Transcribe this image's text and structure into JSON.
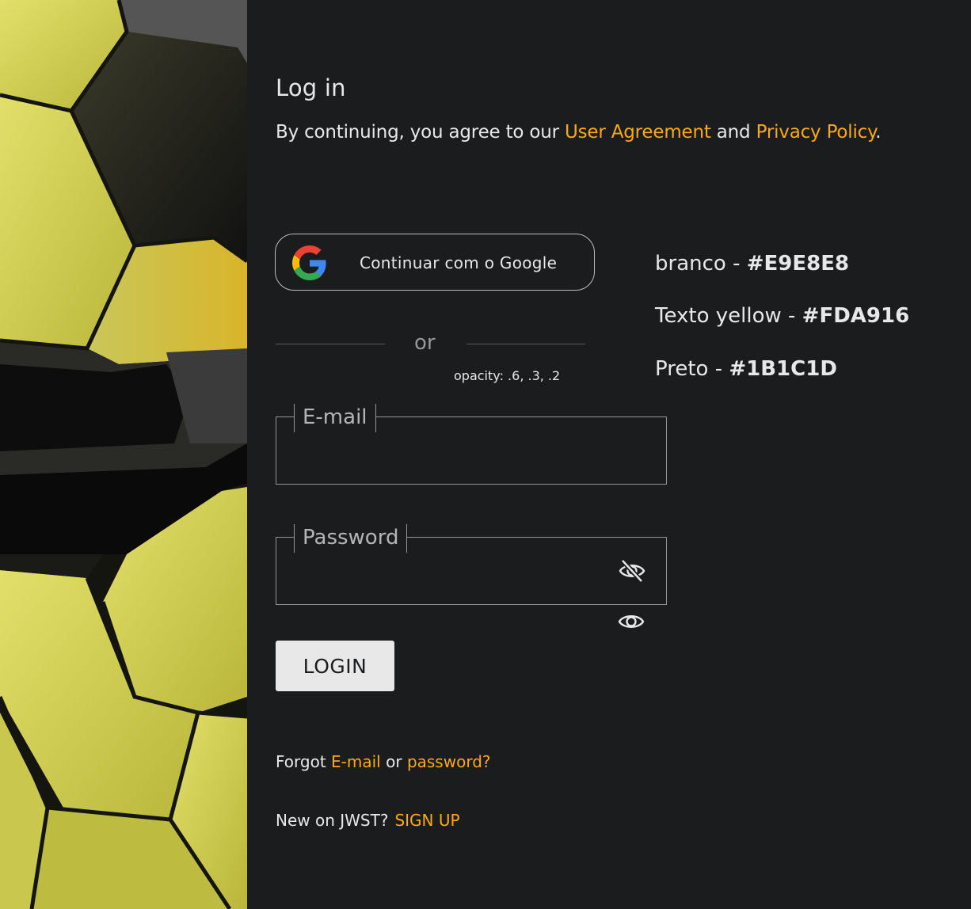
{
  "colors": {
    "white": "#E9E8E8",
    "yellow_text": "#FDA916",
    "black": "#1B1C1D",
    "hex_yellow": "#D3D34E"
  },
  "hero": {
    "image": "yellow-hexagon-tiles"
  },
  "login": {
    "title": "Log in",
    "agreement_prefix": "By continuing, you agree to our ",
    "user_agreement_link": "User Agreement",
    "agreement_and": " and ",
    "privacy_policy_link": "Privacy Policy",
    "agreement_suffix": ".",
    "google_button_label": "Continuar com o Google",
    "google_icon": "google-g-icon",
    "or_label": "or",
    "opacity_note": "opacity: .6, .3, .2",
    "email_label": "E-mail",
    "email_value": "",
    "password_label": "Password",
    "password_value": "",
    "hide_password_icon": "eye-slash-icon",
    "show_password_icon": "eye-icon",
    "login_button": "LOGIN",
    "forgot_prefix": "Forgot ",
    "forgot_email_link": "E-mail",
    "forgot_or": " or ",
    "forgot_password_link": "password?",
    "new_on_text": "New on JWST?",
    "signup_link": "SIGN UP"
  },
  "palette": [
    {
      "label": "branco - ",
      "value": "#E9E8E8"
    },
    {
      "label": "Texto yellow - ",
      "value": "#FDA916"
    },
    {
      "label": "Preto - ",
      "value": "#1B1C1D"
    }
  ],
  "palette_display": [
    "#E9E8E8",
    "#FDA916",
    "#1B1C1D"
  ]
}
